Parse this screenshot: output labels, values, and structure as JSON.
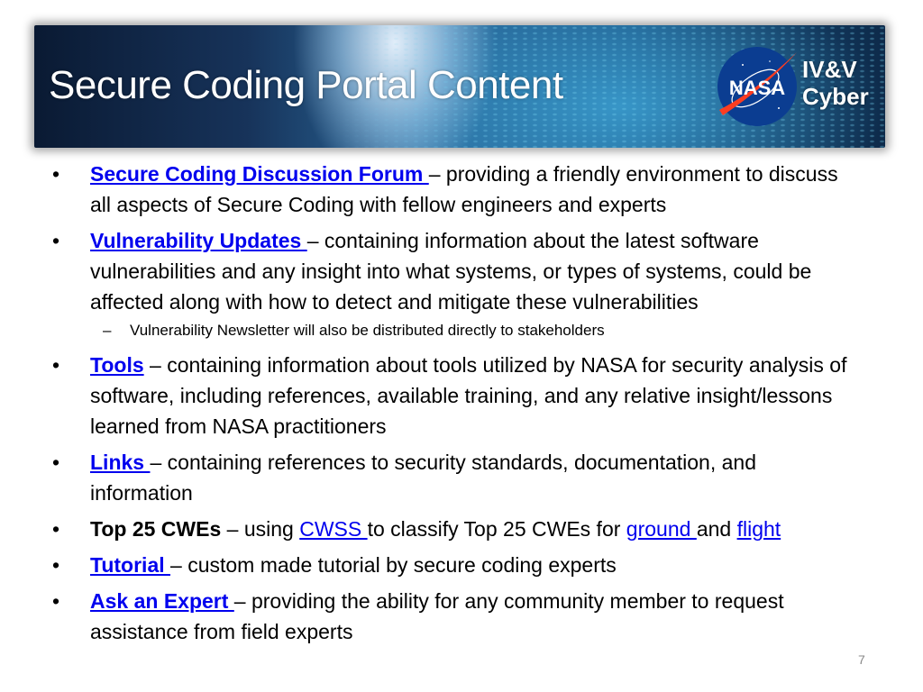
{
  "header": {
    "title": "Secure Coding Portal Content",
    "logo_text": "NASA",
    "org_line1": "IV&V",
    "org_line2": "Cyber"
  },
  "bullets": [
    {
      "link": "Secure Coding Discussion Forum ",
      "text": "– providing a friendly environment to discuss all aspects of Secure Coding with fellow engineers and experts"
    },
    {
      "link": "Vulnerability Updates ",
      "text": "– containing information about the latest software vulnerabilities and any insight into what systems, or types of systems, could be affected along with how to detect and mitigate these vulnerabilities",
      "sub": "Vulnerability Newsletter will also be distributed directly to stakeholders"
    },
    {
      "link": "Tools",
      "text": " – containing information about tools utilized by NASA for security analysis of software, including references, available training, and any relative insight/lessons learned from NASA practitioners"
    },
    {
      "link": "Links ",
      "text": "– containing references to security standards, documentation, and information"
    },
    {
      "bold": "Top 25 CWEs",
      "text1": " – using ",
      "link1": "CWSS ",
      "text2": "to classify Top 25 CWEs for ",
      "link2": "ground ",
      "text3": "and ",
      "link3": "flight"
    },
    {
      "link": "Tutorial ",
      "text": "– custom made tutorial by secure coding experts"
    },
    {
      "link": "Ask an Expert ",
      "text": "– providing the ability for any community member to request assistance from field experts"
    }
  ],
  "bullet_glyph": "•",
  "sub_glyph": "–",
  "page_number": "7"
}
